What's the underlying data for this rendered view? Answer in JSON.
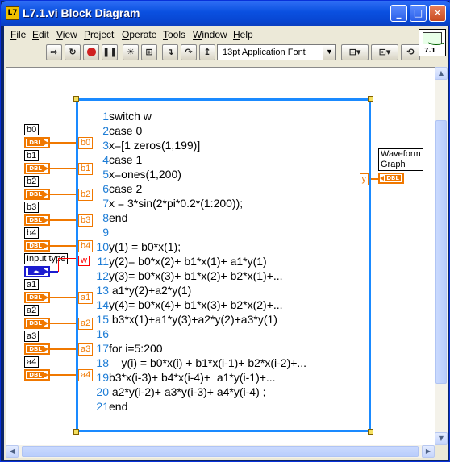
{
  "window": {
    "title": "L7.1.vi Block Diagram",
    "app_icon_text": "L7",
    "controls": {
      "minimize": "_",
      "maximize": "□",
      "close": "✕"
    }
  },
  "menu": [
    "File",
    "Edit",
    "View",
    "Project",
    "Operate",
    "Tools",
    "Window",
    "Help"
  ],
  "toolbar": {
    "font_select": "13pt Application Font",
    "icon_number": "7.1"
  },
  "controls": [
    {
      "label": "b0",
      "tag": "DBL",
      "terminal": "b0"
    },
    {
      "label": "b1",
      "tag": "DBL",
      "terminal": "b1"
    },
    {
      "label": "b2",
      "tag": "DBL",
      "terminal": "b2"
    },
    {
      "label": "b3",
      "tag": "DBL",
      "terminal": "b3"
    },
    {
      "label": "b4",
      "tag": "DBL",
      "terminal": "b4"
    },
    {
      "label": "Input type",
      "tag": "◂▸",
      "terminal": "w"
    },
    {
      "label": "a1",
      "tag": "DBL",
      "terminal": "a1"
    },
    {
      "label": "a2",
      "tag": "DBL",
      "terminal": "a2"
    },
    {
      "label": "a3",
      "tag": "DBL",
      "terminal": "a3"
    },
    {
      "label": "a4",
      "tag": "DBL",
      "terminal": "a4"
    }
  ],
  "indicator": {
    "label_line1": "Waveform",
    "label_line2": "Graph",
    "tag": "DBL",
    "terminal": "y"
  },
  "code_lines": [
    {
      "n": "1",
      "text": "switch w"
    },
    {
      "n": "2",
      "text": "case 0"
    },
    {
      "n": "3",
      "text": "x=[1 zeros(1,199)]"
    },
    {
      "n": "4",
      "text": "case 1"
    },
    {
      "n": "5",
      "text": "x=ones(1,200)"
    },
    {
      "n": "6",
      "text": "case 2"
    },
    {
      "n": "7",
      "text": "x = 3*sin(2*pi*0.2*(1:200));"
    },
    {
      "n": "8",
      "text": "end"
    },
    {
      "n": "9",
      "text": ""
    },
    {
      "n": "10",
      "text": "y(1) = b0*x(1);"
    },
    {
      "n": "11",
      "text": "y(2)= b0*x(2)+ b1*x(1)+ a1*y(1)"
    },
    {
      "n": "12",
      "text": "y(3)= b0*x(3)+ b1*x(2)+ b2*x(1)+..."
    },
    {
      "n": "13",
      "text": " a1*y(2)+a2*y(1)"
    },
    {
      "n": "14",
      "text": "y(4)= b0*x(4)+ b1*x(3)+ b2*x(2)+..."
    },
    {
      "n": "15",
      "text": " b3*x(1)+a1*y(3)+a2*y(2)+a3*y(1)"
    },
    {
      "n": "16",
      "text": ""
    },
    {
      "n": "17",
      "text": "for i=5:200"
    },
    {
      "n": "18",
      "text": "    y(i) = b0*x(i) + b1*x(i-1)+ b2*x(i-2)+..."
    },
    {
      "n": "19",
      "text": "b3*x(i-3)+ b4*x(i-4)+  a1*y(i-1)+..."
    },
    {
      "n": "20",
      "text": " a2*y(i-2)+ a3*y(i-3)+ a4*y(i-4) ;"
    },
    {
      "n": "21",
      "text": "end"
    }
  ],
  "scrollbars": {
    "up": "▲",
    "down": "▼",
    "left": "◀",
    "right": "▶"
  }
}
